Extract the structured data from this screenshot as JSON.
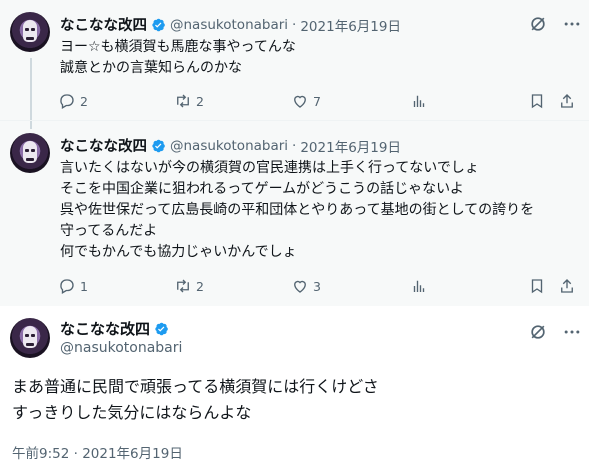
{
  "tweets": [
    {
      "name": "なこなな改四",
      "handle": "@nasukotonabari",
      "separator": "·",
      "date": "2021年6月19日",
      "text": "ヨー☆も横須賀も馬鹿な事やってんな\n誠意とかの言葉知らんのかな",
      "replies": "2",
      "retweets": "2",
      "likes": "7"
    },
    {
      "name": "なこなな改四",
      "handle": "@nasukotonabari",
      "separator": "·",
      "date": "2021年6月19日",
      "text": "言いたくはないが今の横須賀の官民連携は上手く行ってないでしょ\nそこを中国企業に狙われるってゲームがどうこうの話じゃないよ\n呉や佐世保だって広島長崎の平和団体とやりあって基地の街としての誇りを\n守ってるんだよ\n何でもかんでも協力じゃいかんでしょ",
      "replies": "1",
      "retweets": "2",
      "likes": "3"
    }
  ],
  "main_tweet": {
    "name": "なこなな改四",
    "handle": "@nasukotonabari",
    "text": "まあ普通に民間で頑張ってる横須賀には行くけどさ\nすっきりした気分にはならんよな",
    "timestamp": "午前9:52 · 2021年6月19日"
  },
  "icons": [
    "verified-badge-icon",
    "grok-icon",
    "more-icon",
    "reply-icon",
    "retweet-icon",
    "like-icon",
    "views-icon",
    "bookmark-icon",
    "share-icon"
  ],
  "colors": {
    "verified": "#1d9bf0",
    "secondary_text": "#536471",
    "thread_line": "#cfd9de"
  }
}
